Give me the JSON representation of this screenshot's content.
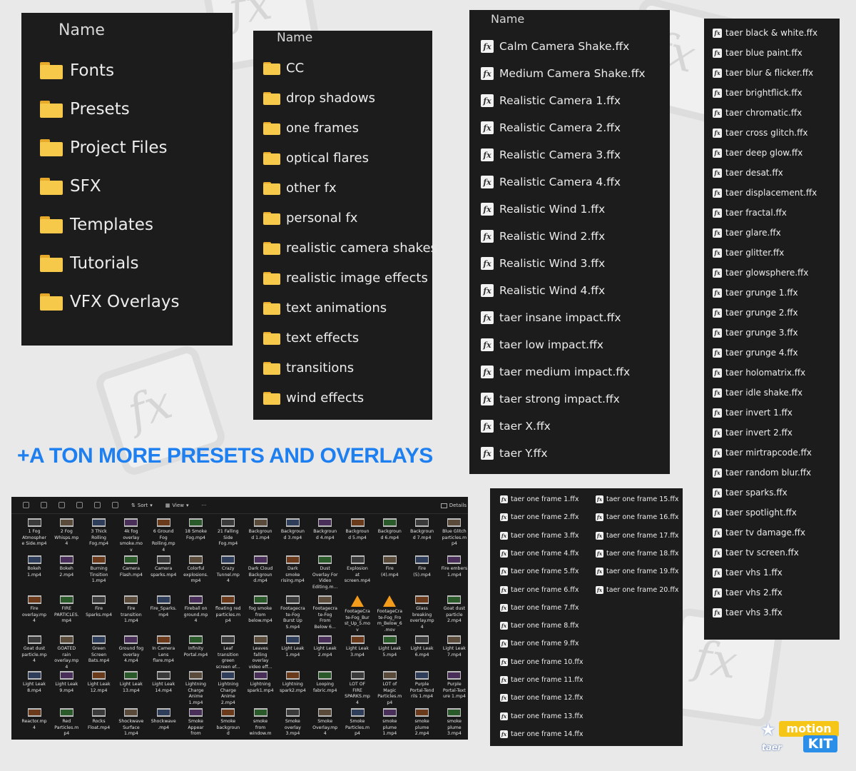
{
  "panels": {
    "main_folders": {
      "header": "Name",
      "items": [
        "Fonts",
        "Presets",
        "Project Files",
        "SFX",
        "Templates",
        "Tutorials",
        "VFX Overlays"
      ]
    },
    "preset_folders": {
      "header": "Name",
      "items": [
        "CC",
        "drop shadows",
        "one frames",
        "optical flares",
        "other fx",
        "personal fx",
        "realistic camera shakes",
        "realistic image effects",
        "text animations",
        "text effects",
        "transitions",
        "wind effects"
      ]
    },
    "ffx_files": {
      "header": "Name",
      "items": [
        "Calm Camera Shake.ffx",
        "Medium Camera Shake.ffx",
        "Realistic Camera 1.ffx",
        "Realistic Camera 2.ffx",
        "Realistic Camera 3.ffx",
        "Realistic Camera 4.ffx",
        "Realistic Wind 1.ffx",
        "Realistic Wind 2.ffx",
        "Realistic Wind 3.ffx",
        "Realistic Wind 4.ffx",
        "taer insane impact.ffx",
        "taer low impact.ffx",
        "taer medium impact.ffx",
        "taer strong impact.ffx",
        "taer X.ffx",
        "taer Y.ffx"
      ]
    },
    "taer_effects": {
      "items": [
        "taer black & white.ffx",
        "taer blue paint.ffx",
        "taer blur & flicker.ffx",
        "taer brightflick.ffx",
        "taer chromatic.ffx",
        "taer cross glitch.ffx",
        "taer deep glow.ffx",
        "taer desat.ffx",
        "taer displacement.ffx",
        "taer fractal.ffx",
        "taer glare.ffx",
        "taer glitter.ffx",
        "taer glowsphere.ffx",
        "taer grunge 1.ffx",
        "taer grunge 2.ffx",
        "taer grunge 3.ffx",
        "taer grunge 4.ffx",
        "taer holomatrix.ffx",
        "taer idle shake.ffx",
        "taer invert 1.ffx",
        "taer invert 2.ffx",
        "taer mirtrapcode.ffx",
        "taer random blur.ffx",
        "taer sparks.ffx",
        "taer spotlight.ffx",
        "taer tv damage.ffx",
        "taer tv screen.ffx",
        "taer vhs 1.ffx",
        "taer vhs 2.ffx",
        "taer vhs 3.ffx"
      ]
    },
    "one_frames": {
      "left": [
        "taer one frame 1.ffx",
        "taer one frame 2.ffx",
        "taer one frame 3.ffx",
        "taer one frame 4.ffx",
        "taer one frame 5.ffx",
        "taer one frame 6.ffx",
        "taer one frame 7.ffx",
        "taer one frame 8.ffx",
        "taer one frame 9.ffx",
        "taer one frame 10.ffx",
        "taer one frame 11.ffx",
        "taer one frame 12.ffx",
        "taer one frame 13.ffx",
        "taer one frame 14.ffx"
      ],
      "right": [
        "taer one frame 15.ffx",
        "taer one frame 16.ffx",
        "taer one frame 17.ffx",
        "taer one frame 18.ffx",
        "taer one frame 19.ffx",
        "taer one frame 20.ffx"
      ]
    }
  },
  "tagline": "+A TON MORE PRESETS AND OVERLAYS",
  "explorer": {
    "toolbar": {
      "sort_label": "Sort",
      "view_label": "View",
      "more_label": "···",
      "details_label": "Details"
    },
    "files": [
      [
        "1 Fog",
        "Atmospher",
        "e Side.mp4"
      ],
      [
        "2 Fog",
        "Whisps.mp",
        "4"
      ],
      [
        "3 Thick",
        "Rolling",
        "Fog.mp4"
      ],
      [
        "4k fog",
        "overlay",
        "smoke.mo",
        "v"
      ],
      [
        "6 Ground",
        "Fog",
        "Rolling.mp",
        "4"
      ],
      [
        "18 Smoke",
        "Fog.mp4"
      ],
      [
        "21 Falling",
        "Side",
        "Fog.mp4"
      ],
      [
        "Backgroun",
        "d 1.mp4"
      ],
      [
        "Backgroun",
        "d 3.mp4"
      ],
      [
        "Backgroun",
        "d 4.mp4"
      ],
      [
        "Backgroun",
        "d 5.mp4"
      ],
      [
        "Backgroun",
        "d 6.mp4"
      ],
      [
        "Backgroun",
        "d 7.mp4"
      ],
      [
        "Blue Glitch",
        "particles.m",
        "p4"
      ],
      [
        "Bokeh",
        "1.mp4"
      ],
      [
        "Bokeh",
        "2.mp4"
      ],
      [
        "Burning",
        "Tinsition",
        "1.mp4"
      ],
      [
        "Camera",
        "Flash.mp4"
      ],
      [
        "Camera",
        "sparks.mp4"
      ],
      [
        "Colorful",
        "explosions.",
        "mp4"
      ],
      [
        "Crazy",
        "Tunnel.mp",
        "4"
      ],
      [
        "Dark Cloud",
        "Backgroun",
        "d.mp4"
      ],
      [
        "Dark",
        "smoke",
        "rising.mp4"
      ],
      [
        "Dust",
        "Overlay For",
        "Video",
        "Editing.m..."
      ],
      [
        "Explosion",
        "at",
        "screen.mp4"
      ],
      [
        "Fire",
        "(4).mp4"
      ],
      [
        "Fire",
        "(5).mp4"
      ],
      [
        "Fire embers",
        "1.mp4"
      ],
      [
        "Fire",
        "overlay.mp",
        "4"
      ],
      [
        "FIRE",
        "PARTICLES.",
        "mp4"
      ],
      [
        "Fire",
        "Sparks.mp4"
      ],
      [
        "Fire",
        "transition",
        "1.mp4"
      ],
      [
        "Fire_Sparks.",
        "mp4"
      ],
      [
        "Fireball on",
        "ground.mp",
        "4"
      ],
      [
        "floating red",
        "particles.m",
        "p4"
      ],
      [
        "fog smoke",
        "from",
        "below.mp4"
      ],
      [
        "Footagecra",
        "te-Fog",
        "Burst Up",
        "S.mp4"
      ],
      [
        "Footagecra",
        "te-Fog",
        "From",
        "Below 6..."
      ],
      [
        "FootageCra",
        "te-Fog_Bur",
        "st_Up_5.mo",
        "v"
      ],
      [
        "FootageCra",
        "te-Fog_Fro",
        "m_Below_6",
        ".mov"
      ],
      [
        "Glass",
        "breaking",
        "overlay.mp",
        "4"
      ],
      [
        "Goat dust",
        "particle",
        "2.mp4"
      ],
      [
        "Goat dust",
        "particle.mp",
        "4"
      ],
      [
        "GOATED",
        "rain",
        "overlay.mp",
        "4"
      ],
      [
        "Green",
        "Screen",
        "Bats.mp4"
      ],
      [
        "Ground fog",
        "overlay",
        "4.mp4"
      ],
      [
        "In Camera",
        "Lens",
        "flare.mp4"
      ],
      [
        "Infinity",
        "Portal.mp4"
      ],
      [
        "Leaf",
        "transition",
        "green",
        "screen ef..."
      ],
      [
        "Leaves",
        "falling",
        "overlay",
        "video eff..."
      ],
      [
        "Light Leak",
        "1.mp4"
      ],
      [
        "Light Leak",
        "2.mp4"
      ],
      [
        "Light Leak",
        "3.mp4"
      ],
      [
        "Light Leak",
        "5.mp4"
      ],
      [
        "Light Leak",
        "6.mp4"
      ],
      [
        "Light Leak",
        "7.mp4"
      ],
      [
        "Light Leak",
        "8.mp4"
      ],
      [
        "Light Leak",
        "9.mp4"
      ],
      [
        "Light Leak",
        "12.mp4"
      ],
      [
        "Light Leak",
        "13.mp4"
      ],
      [
        "Light Leak",
        "14.mp4"
      ],
      [
        "Lightning",
        "Charge",
        "Anime",
        "1.mp4"
      ],
      [
        "Lightning",
        "Charge",
        "Anime",
        "2.mp4"
      ],
      [
        "Lightning",
        "spark1.mp4"
      ],
      [
        "Lightning",
        "spark2.mp4"
      ],
      [
        "Looping",
        "fabric.mp4"
      ],
      [
        "LOT OF",
        "FIRE",
        "SPARKS.mp",
        "4"
      ],
      [
        "LOT of",
        "Magic",
        "Particles.m",
        "p4"
      ],
      [
        "Purple",
        "Portal-Tend",
        "rils 1.mp4"
      ],
      [
        "Purple",
        "Portal-Text",
        "ure 1.mp4"
      ],
      [
        "Reactor.mp",
        "4"
      ],
      [
        "Red",
        "Particles.m",
        "p4"
      ],
      [
        "Rocks",
        "Float.mp4"
      ],
      [
        "Shockwave",
        "Surface",
        "1.mp4"
      ],
      [
        "Shockwave",
        ".mp4"
      ],
      [
        "Smoke",
        "Appear",
        "from"
      ],
      [
        "Smoke",
        "backgroun",
        "d"
      ],
      [
        "smoke",
        "from",
        "window.m"
      ],
      [
        "Smoke",
        "overlay",
        "3.mp4"
      ],
      [
        "Smoke",
        "Overlay.mp",
        "4"
      ],
      [
        "Smoke",
        "Particles.m",
        "p4"
      ],
      [
        "smoke",
        "plume",
        "1.mp4"
      ],
      [
        "smoke",
        "plume",
        "2.mp4"
      ],
      [
        "smoke",
        "plume",
        "3.mp4"
      ]
    ]
  },
  "logo": {
    "motion": "motion",
    "kit": "KIT",
    "brand": "taer"
  }
}
